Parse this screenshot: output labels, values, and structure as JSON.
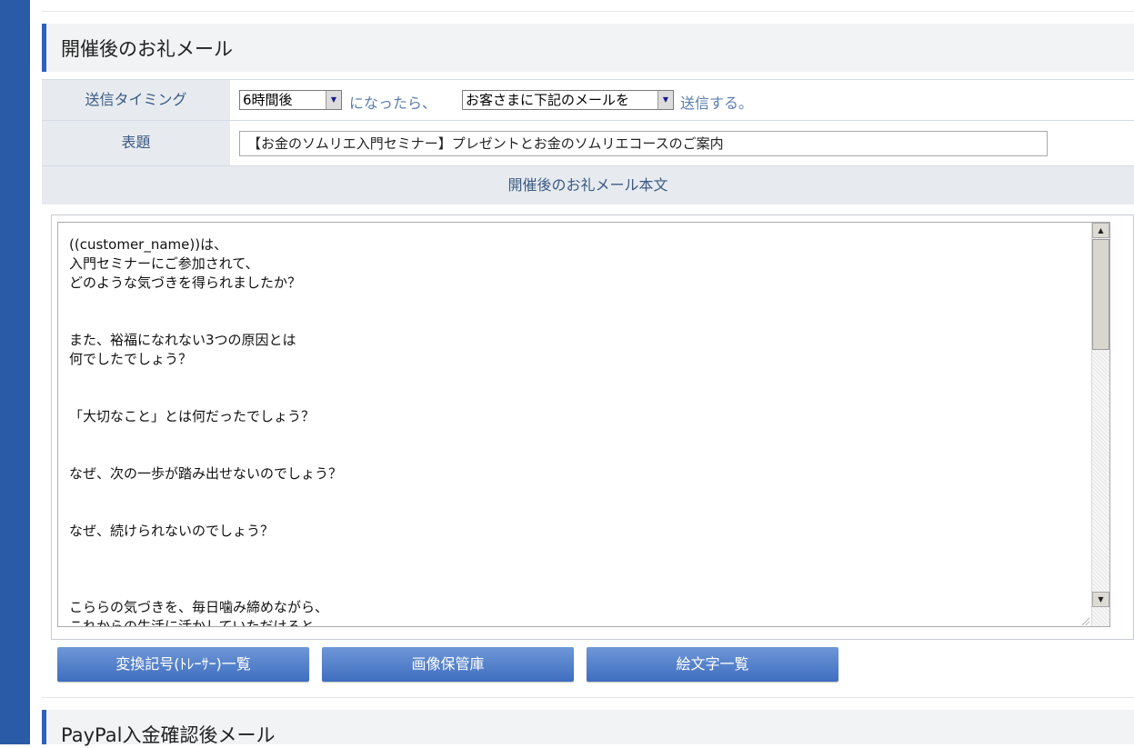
{
  "section1": {
    "title": "開催後のお礼メール",
    "timing_label": "送信タイミング",
    "timing_value": "6時間後",
    "timing_text1": "になったら、",
    "action_value": "お客さまに下記のメールを",
    "timing_text2": "送信する。",
    "subject_label": "表題",
    "subject_value": "【お金のソムリエ入門セミナー】プレゼントとお金のソムリエコースのご案内",
    "body_label": "開催後のお礼メール本文",
    "body_lines": [
      "((customer_name))は、",
      "入門セミナーにご参加されて、",
      "どのような気づきを得られましたか？",
      "",
      "",
      "また、裕福になれない3つの原因とは",
      "何でしたでしょう？",
      "",
      "",
      "「大切なこと」とは何だったでしょう？",
      "",
      "",
      "なぜ、次の一歩が踏み出せないのでしょう？",
      "",
      "",
      "なぜ、続けられないのでしょう？",
      "",
      "",
      "",
      "こららの気づきを、毎日噛み締めながら、",
      "これからの生活に活かしていただけると"
    ]
  },
  "buttons": {
    "tracer_list": "変換記号(ﾄﾚｰｻｰ)一覧",
    "image_storage": "画像保管庫",
    "emoji_list": "絵文字一覧"
  },
  "section2": {
    "title": "PayPal入金確認後メール"
  },
  "colors": {
    "accent": "#2f62b8",
    "sidebar": "#2a5ba6",
    "label_bg": "#e7ebf0",
    "label_text": "#3c5a82"
  }
}
